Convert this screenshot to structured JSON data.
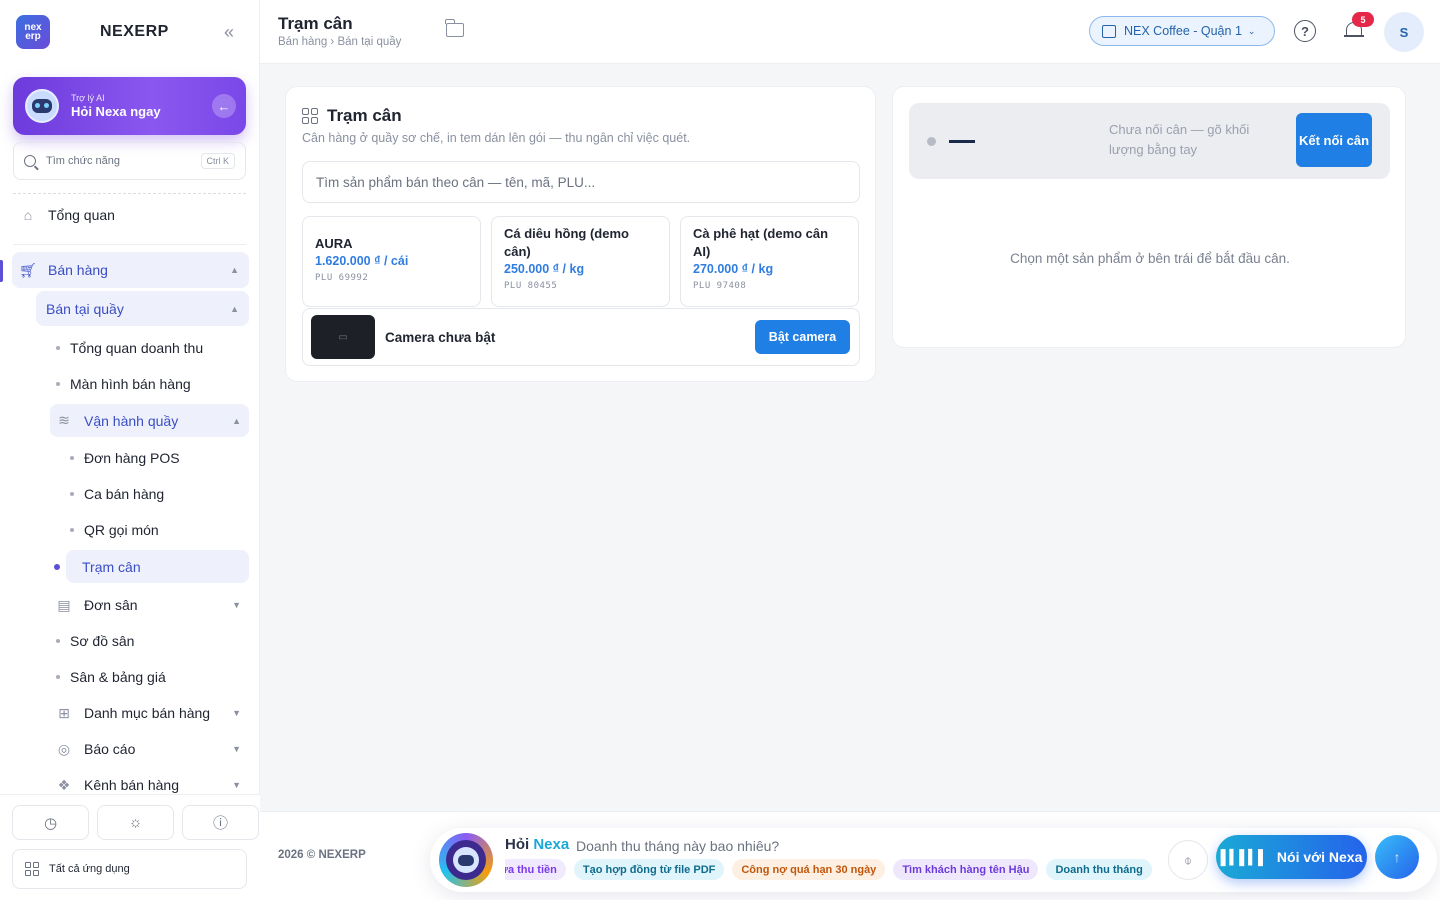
{
  "brand": {
    "logo_text": "nex erp",
    "name": "NEXERP"
  },
  "sidebar": {
    "ai_card": {
      "small": "Trợ lý AI",
      "big": "Hỏi Nexa ngay"
    },
    "search": {
      "placeholder": "Tìm chức năng",
      "shortcut": "Ctrl K"
    },
    "items": {
      "overview": "Tổng quan",
      "sales": "Bán hàng",
      "counter_sales": "Bán tại quầy",
      "revenue_overview": "Tổng quan doanh thu",
      "sales_screen": "Màn hình bán hàng",
      "counter_ops": "Vận hành quầy",
      "pos_orders": "Đơn hàng POS",
      "shifts": "Ca bán hàng",
      "qr_order": "QR gọi món",
      "scale_station": "Trạm cân",
      "court_orders": "Đơn sân",
      "court_map": "Sơ đồ sân",
      "court_prices": "Sân & bảng giá",
      "catalog": "Danh mục bán hàng",
      "reports": "Báo cáo",
      "channels": "Kênh bán hàng"
    },
    "all_apps": "Tất cả ứng dụng"
  },
  "topbar": {
    "title": "Trạm cân",
    "breadcrumb": "Bán hàng › Bán tại quầy",
    "store": "NEX Coffee - Quận 1",
    "help": "?",
    "notif_count": "5",
    "avatar": "S"
  },
  "left_card": {
    "title": "Trạm cân",
    "subtitle": "Cân hàng ở quầy sơ chế, in tem dán lên gói — thu ngân chỉ việc quét.",
    "search_placeholder": "Tìm sản phẩm bán theo cân — tên, mã, PLU...",
    "products": [
      {
        "name": "AURA",
        "price": "1.620.000 ₫ / cái",
        "plu": "PLU 69992"
      },
      {
        "name": "Cá diêu hồng (demo cân)",
        "price": "250.000 ₫ / kg",
        "plu": "PLU 80455"
      },
      {
        "name": "Cà phê hạt (demo cân AI)",
        "price": "270.000 ₫ / kg",
        "plu": "PLU 97408"
      }
    ],
    "camera_label": "Camera chưa bật",
    "camera_button": "Bật camera"
  },
  "right_card": {
    "weight_display": "—",
    "note": "Chưa nối cân — gõ khối lượng bằng tay",
    "connect_button": "Kết nối cân",
    "empty": "Chọn một sản phẩm ở bên trái để bắt đầu cân."
  },
  "footer": {
    "copyright": "2026 © NEXERP",
    "ask_prefix": "Hỏi",
    "ask_name": "Nexa",
    "question": "Doanh thu tháng này bao nhiêu?",
    "chips": [
      "ửa thu tiền",
      "Tạo hợp đồng từ file PDF",
      "Công nợ quá hạn 30 ngày",
      "Tìm khách hàng tên Hậu",
      "Doanh thu tháng"
    ],
    "voice_button": "Nói với Nexa"
  }
}
